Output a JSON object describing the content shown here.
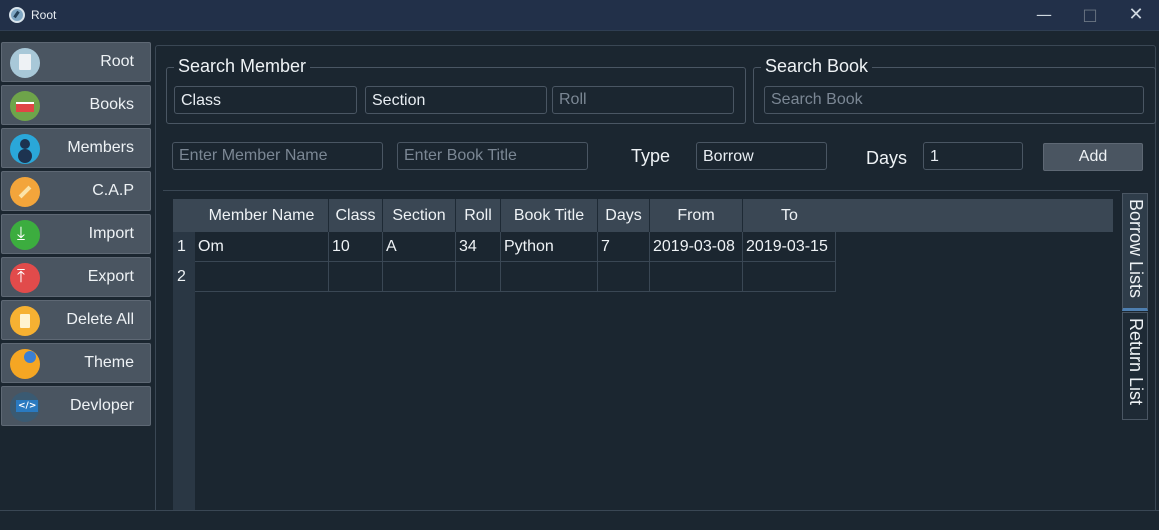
{
  "window": {
    "title": "Root",
    "minimize": "—",
    "maximize": "□",
    "close": "✕"
  },
  "sidebar": {
    "items": [
      {
        "label": "Root",
        "icon": "root-icon"
      },
      {
        "label": "Books",
        "icon": "books-icon"
      },
      {
        "label": "Members",
        "icon": "members-icon"
      },
      {
        "label": "C.A.P",
        "icon": "cap-icon"
      },
      {
        "label": "Import",
        "icon": "import-icon"
      },
      {
        "label": "Export",
        "icon": "export-icon"
      },
      {
        "label": "Delete All",
        "icon": "delete-icon"
      },
      {
        "label": "Theme",
        "icon": "theme-icon"
      },
      {
        "label": "Devloper",
        "icon": "developer-icon"
      }
    ]
  },
  "search_member": {
    "title": "Search Member",
    "class_value": "Class",
    "section_value": "Section",
    "roll_placeholder": "Roll"
  },
  "search_book": {
    "title": "Search Book",
    "placeholder": "Search Book"
  },
  "entry": {
    "member_placeholder": "Enter Member Name",
    "book_placeholder": "Enter Book Title",
    "type_label": "Type",
    "type_value": "Borrow",
    "days_label": "Days",
    "days_value": "1",
    "add_label": "Add"
  },
  "table": {
    "columns": [
      "Member Name",
      "Class",
      "Section",
      "Roll",
      "Book Title",
      "Days",
      "From",
      "To"
    ],
    "row_numbers": [
      "1",
      "2"
    ],
    "rows": [
      [
        "Om",
        "10",
        "A",
        "34",
        "Python",
        "7",
        "2019-03-08",
        "2019-03-15"
      ],
      [
        "",
        "",
        "",
        "",
        "",
        "",
        "",
        ""
      ]
    ]
  },
  "tabs": {
    "borrow": "Borrow Lists",
    "return": "Return List"
  },
  "colors": {
    "background": "#1b2630",
    "titlebar": "#223049",
    "button": "#4a5561",
    "header": "#3a4754"
  }
}
